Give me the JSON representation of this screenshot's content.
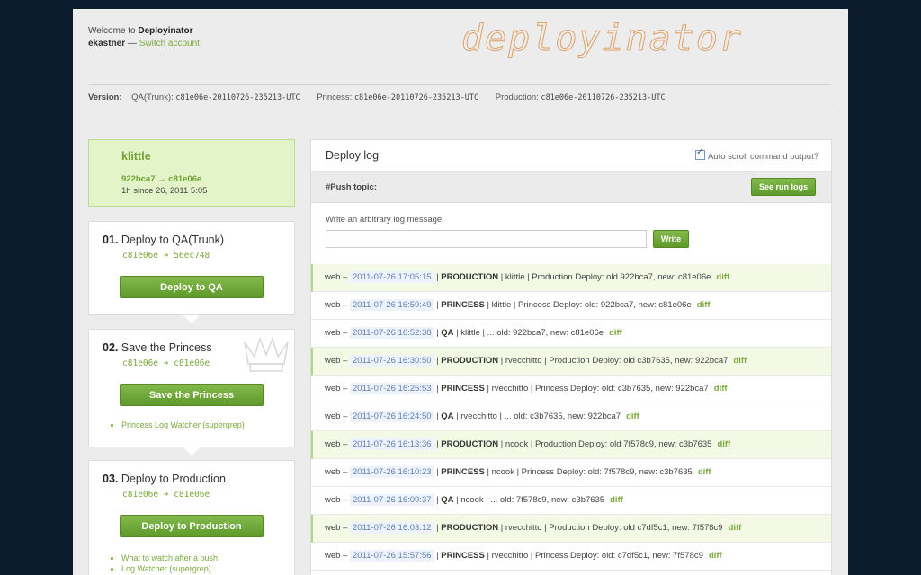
{
  "welcome": {
    "prefix": "Welcome to ",
    "app": "Deployinator",
    "user": "ekastner",
    "sep": " — ",
    "switch": "Switch account"
  },
  "logo_text": "deployinator",
  "versions": {
    "label": "Version:",
    "items": [
      {
        "name": "QA(Trunk):",
        "value": "c81e06e-20110726-235213-UTC"
      },
      {
        "name": "Princess:",
        "value": "c81e06e-20110726-235213-UTC"
      },
      {
        "name": "Production:",
        "value": "c81e06e-20110726-235213-UTC"
      }
    ]
  },
  "current": {
    "user": "klittle",
    "range": "922bca7 → c81e06e",
    "since": "1h since 26, 2011 5:05"
  },
  "steps": [
    {
      "num": "01.",
      "title": "Deploy to QA(Trunk)",
      "shas": "c81e06e ➔ 56ec748",
      "button": "Deploy to QA",
      "links": []
    },
    {
      "num": "02.",
      "title": "Save the Princess",
      "shas": "c81e06e ➔ c81e06e",
      "button": "Save the Princess",
      "links": [
        "Princess Log Watcher (supergrep)"
      ]
    },
    {
      "num": "03.",
      "title": "Deploy to Production",
      "shas": "c81e06e ➔ c81e06e",
      "button": "Deploy to Production",
      "links": [
        "What to watch after a push",
        "Log Watcher (supergrep)"
      ]
    }
  ],
  "log": {
    "title": "Deploy log",
    "auto_scroll": "Auto scroll command output?",
    "auto_scroll_checked": true,
    "topic": "#Push topic:",
    "run_logs_button": "See run logs",
    "write_label": "Write an arbitrary log message",
    "write_value": "",
    "write_button": "Write",
    "entries": [
      {
        "src": "web –",
        "ts": "2011-07-26 17:05:15",
        "stage": "PRODUCTION",
        "text": " | klittle | Production Deploy: old 922bca7, new: c81e06e",
        "diff": "diff",
        "prod": true
      },
      {
        "src": "web –",
        "ts": "2011-07-26 16:59:49",
        "stage": "PRINCESS",
        "text": " | klittle | Princess Deploy: old: 922bca7, new: c81e06e",
        "diff": "diff",
        "prod": false
      },
      {
        "src": "web –",
        "ts": "2011-07-26 16:52:38",
        "stage": "QA",
        "text": " | klittle | ... old: 922bca7, new: c81e06e",
        "diff": "diff",
        "prod": false
      },
      {
        "src": "web –",
        "ts": "2011-07-26 16:30:50",
        "stage": "PRODUCTION",
        "text": " | rvecchitto | Production Deploy: old c3b7635, new: 922bca7",
        "diff": "diff",
        "prod": true
      },
      {
        "src": "web –",
        "ts": "2011-07-26 16:25:53",
        "stage": "PRINCESS",
        "text": " | rvecchitto | Princess Deploy: old: c3b7635, new: 922bca7",
        "diff": "diff",
        "prod": false
      },
      {
        "src": "web –",
        "ts": "2011-07-26 16:24:50",
        "stage": "QA",
        "text": " | rvecchitto | ... old: c3b7635, new: 922bca7",
        "diff": "diff",
        "prod": false
      },
      {
        "src": "web –",
        "ts": "2011-07-26 16:13:36",
        "stage": "PRODUCTION",
        "text": " | ncook | Production Deploy: old 7f578c9, new: c3b7635",
        "diff": "diff",
        "prod": true
      },
      {
        "src": "web –",
        "ts": "2011-07-26 16:10:23",
        "stage": "PRINCESS",
        "text": " | ncook | Princess Deploy: old: 7f578c9, new: c3b7635",
        "diff": "diff",
        "prod": false
      },
      {
        "src": "web –",
        "ts": "2011-07-26 16:09:37",
        "stage": "QA",
        "text": " | ncook | ... old: 7f578c9, new: c3b7635",
        "diff": "diff",
        "prod": false
      },
      {
        "src": "web –",
        "ts": "2011-07-26 16:03:12",
        "stage": "PRODUCTION",
        "text": " | rvecchitto | Production Deploy: old c7df5c1, new: 7f578c9",
        "diff": "diff",
        "prod": true
      },
      {
        "src": "web –",
        "ts": "2011-07-26 15:57:56",
        "stage": "PRINCESS",
        "text": " | rvecchitto | Princess Deploy: old: c7df5c1, new: 7f578c9",
        "diff": "diff",
        "prod": false
      }
    ]
  },
  "colors": {
    "accent_green": "#7aa93c",
    "button_green": "#6fa835",
    "background": "#0d1b2f",
    "logo_orange": "#e0a266"
  },
  "icons": {
    "crown": "crown-icon",
    "checkbox": "checkbox-icon"
  }
}
